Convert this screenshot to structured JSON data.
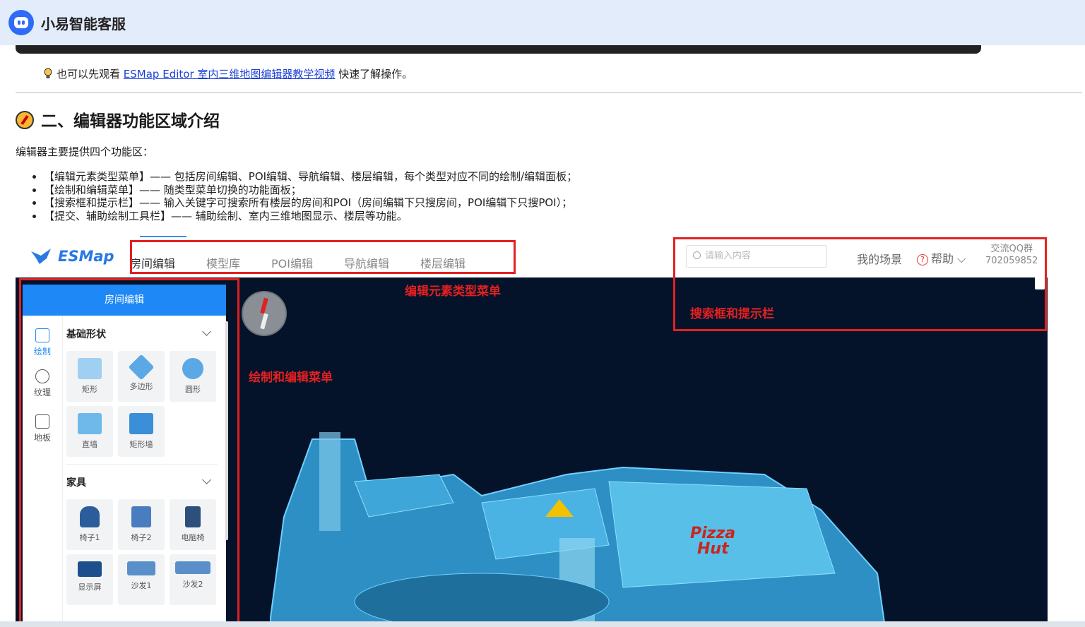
{
  "app": {
    "title": "小易智能客服"
  },
  "article": {
    "tip_prefix": "也可以先观看",
    "tip_link": "ESMap Editor 室内三维地图编辑器教学视频",
    "tip_suffix": "快速了解操作。",
    "heading": "二、编辑器功能区域介绍",
    "intro": "编辑器主要提供四个功能区：",
    "bullets": [
      "【编辑元素类型菜单】—— 包括房间编辑、POI编辑、导航编辑、楼层编辑，每个类型对应不同的绘制/编辑面板；",
      "【绘制和编辑菜单】—— 随类型菜单切换的功能面板；",
      "【搜索框和提示栏】—— 输入关键字可搜索所有楼层的房间和POI（房间编辑下只搜房间，POI编辑下只搜POI）；",
      "【提交、辅助绘制工具栏】—— 辅助绘制、室内三维地图显示、楼层等功能。"
    ]
  },
  "editor": {
    "logo": "ESMap",
    "menu": [
      "房间编辑",
      "模型库",
      "POI编辑",
      "导航编辑",
      "楼层编辑"
    ],
    "search_placeholder": "请输入内容",
    "my_scene": "我的场景",
    "help": "帮助",
    "qq_label": "交流QQ群",
    "qq_number": "702059852",
    "panel": {
      "header": "房间编辑",
      "nav": [
        "绘制",
        "纹理",
        "地板"
      ],
      "section1": "基础形状",
      "shapes": [
        "矩形",
        "多边形",
        "圆形",
        "直墙",
        "矩形墙"
      ],
      "section2": "家具",
      "furniture": [
        "椅子1",
        "椅子2",
        "电脑椅",
        "显示屏",
        "沙发1",
        "沙发2"
      ]
    },
    "map_logos": [
      "Pizza",
      "Hut"
    ]
  },
  "annotations": {
    "menu_label": "编辑元素类型菜单",
    "search_label": "搜索框和提示栏",
    "panel_label": "绘制和编辑菜单",
    "color": "#e42020"
  }
}
